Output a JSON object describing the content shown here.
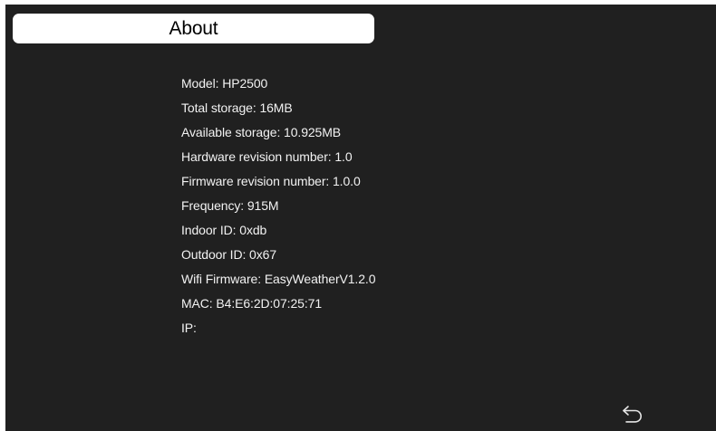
{
  "header": {
    "title": "About"
  },
  "info": {
    "items": [
      {
        "label": "Model",
        "text": "Model: HP2500"
      },
      {
        "label": "Total storage",
        "text": "Total storage: 16MB"
      },
      {
        "label": "Available storage",
        "text": "Available storage: 10.925MB"
      },
      {
        "label": "Hardware revision number",
        "text": "Hardware revision number: 1.0"
      },
      {
        "label": "Firmware revision number",
        "text": "Firmware revision number: 1.0.0"
      },
      {
        "label": "Frequency",
        "text": "Frequency: 915M"
      },
      {
        "label": "Indoor ID",
        "text": "Indoor ID: 0xdb"
      },
      {
        "label": "Outdoor ID",
        "text": "Outdoor ID: 0x67"
      },
      {
        "label": "Wifi Firmware",
        "text": "Wifi Firmware: EasyWeatherV1.2.0"
      },
      {
        "label": "MAC",
        "text": "MAC: B4:E6:2D:07:25:71"
      },
      {
        "label": "IP",
        "text": "IP:"
      }
    ]
  },
  "footer": {
    "back_icon": "return-arrow-icon"
  },
  "colors": {
    "background": "#202020",
    "title_bar": "#ffffff",
    "text": "#f2f2f2"
  }
}
